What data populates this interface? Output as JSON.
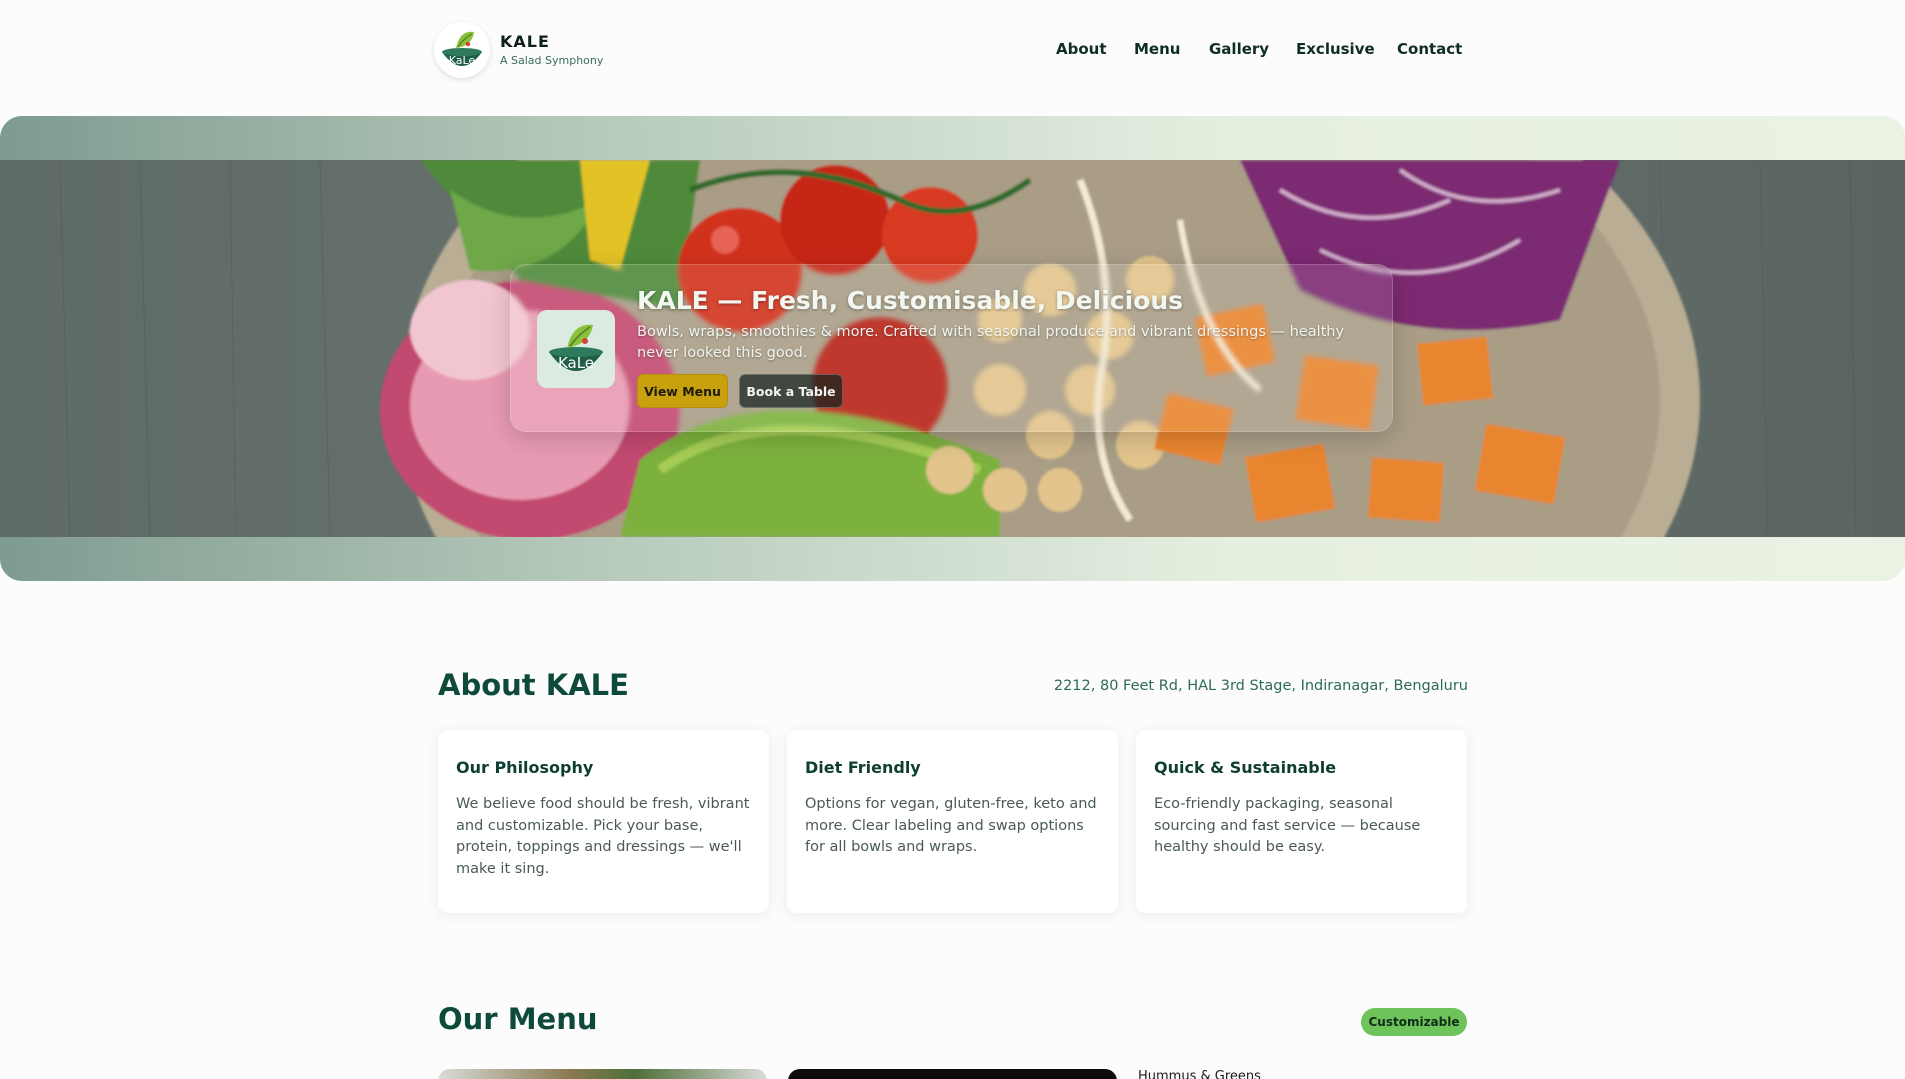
{
  "brand": {
    "name": "KALE",
    "tagline": "A Salad Symphony",
    "logo_text": "KaLe"
  },
  "nav": [
    "About",
    "Menu",
    "Gallery",
    "Exclusive",
    "Contact"
  ],
  "hero": {
    "title": "KALE — Fresh, Customisable, Delicious",
    "subtitle": "Bowls, wraps, smoothies & more. Crafted with seasonal produce and vibrant dressings — healthy never looked this good.",
    "primary_cta": "View Menu",
    "secondary_cta": "Book a Table"
  },
  "about": {
    "title": "About KALE",
    "address": "2212, 80 Feet Rd, HAL 3rd Stage, Indiranagar, Bengaluru",
    "cards": [
      {
        "title": "Our Philosophy",
        "text": "We believe food should be fresh, vibrant and customizable. Pick your base, protein, toppings and dressings — we'll make it sing."
      },
      {
        "title": "Diet Friendly",
        "text": "Options for vegan, gluten-free, keto and more. Clear labeling and swap options for all bowls and wraps."
      },
      {
        "title": "Quick & Sustainable",
        "text": "Eco-friendly packaging, seasonal sourcing and fast service — because healthy should be easy."
      }
    ]
  },
  "menu": {
    "title": "Our Menu",
    "badge": "Customizable",
    "third_item_alt": "Hummus & Greens"
  },
  "colors": {
    "primary": "#0d4a3c",
    "accent": "#c9a10f",
    "badge": "#6ec35a"
  }
}
